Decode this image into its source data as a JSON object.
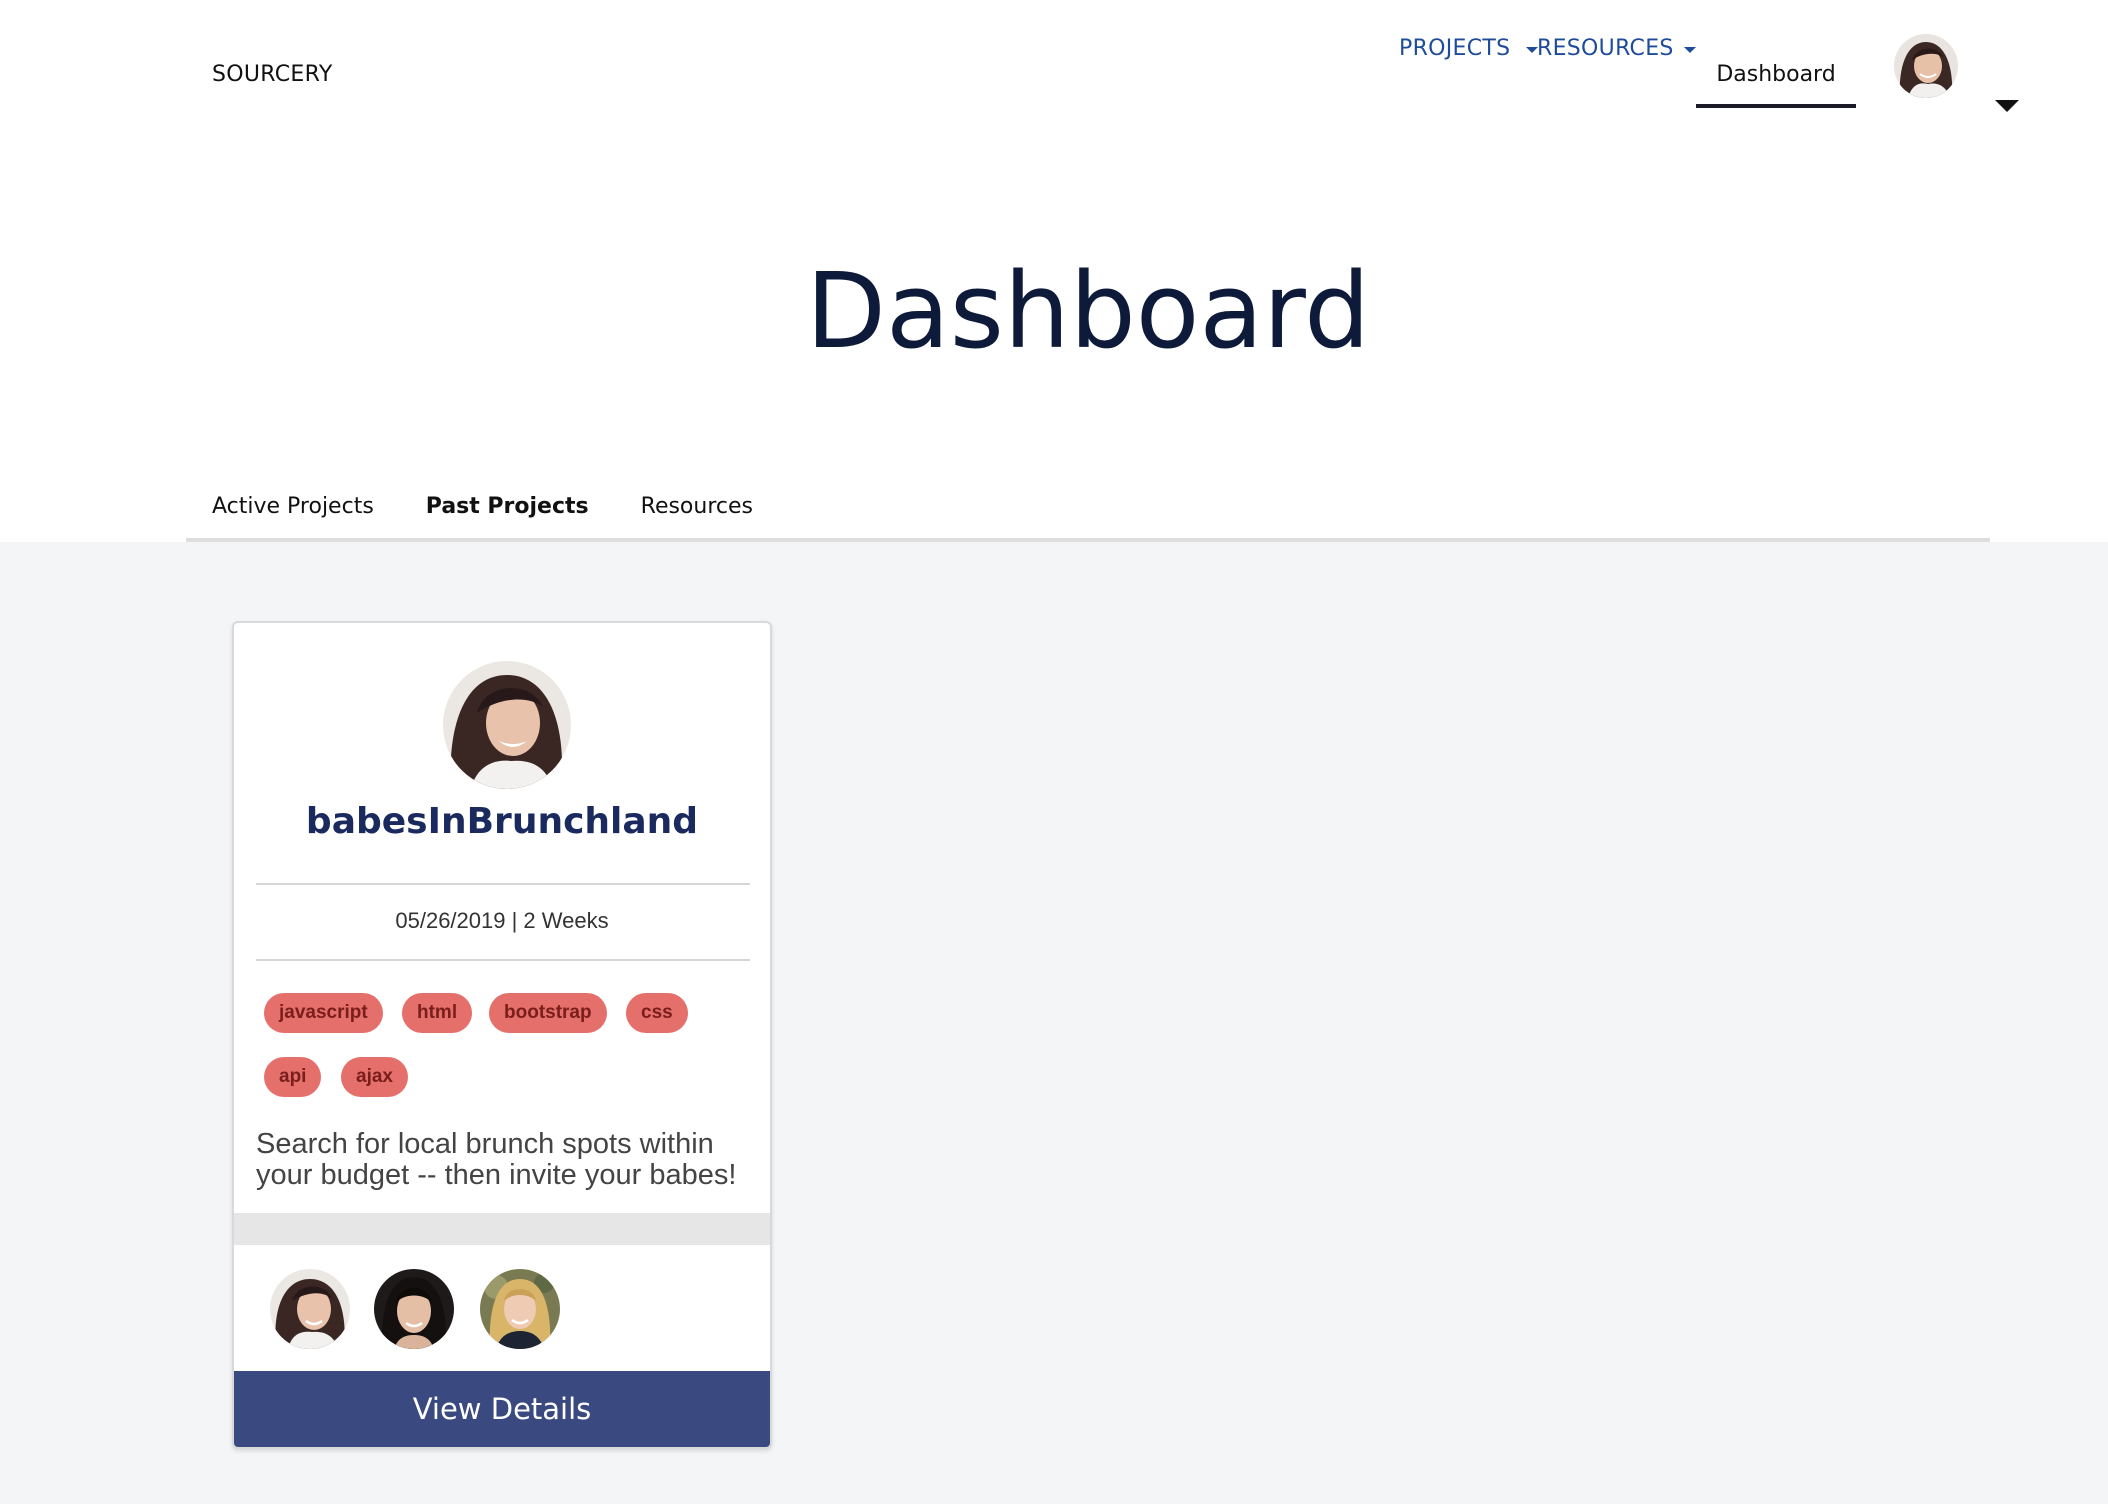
{
  "nav": {
    "brand": "SOURCERY",
    "projects": "PROJECTS",
    "resources": "RESOURCES",
    "dashboard": "Dashboard"
  },
  "title": "Dashboard",
  "tabs": [
    {
      "label": "Active Projects",
      "active": false
    },
    {
      "label": "Past Projects",
      "active": true
    },
    {
      "label": "Resources",
      "active": false
    }
  ],
  "card": {
    "name": "babesInBrunchland",
    "meta": "05/26/2019 | 2 Weeks",
    "tags": [
      "javascript",
      "html",
      "bootstrap",
      "css",
      "api",
      "ajax"
    ],
    "description": "Search for local brunch spots within your budget -- then invite your babes!",
    "button": "View Details"
  },
  "colors": {
    "nav_link": "#1f4c99",
    "title": "#0e1a3a",
    "tag_bg": "#e56f6b",
    "tag_text": "#7a1e1b",
    "button_bg": "#3a4a80"
  }
}
